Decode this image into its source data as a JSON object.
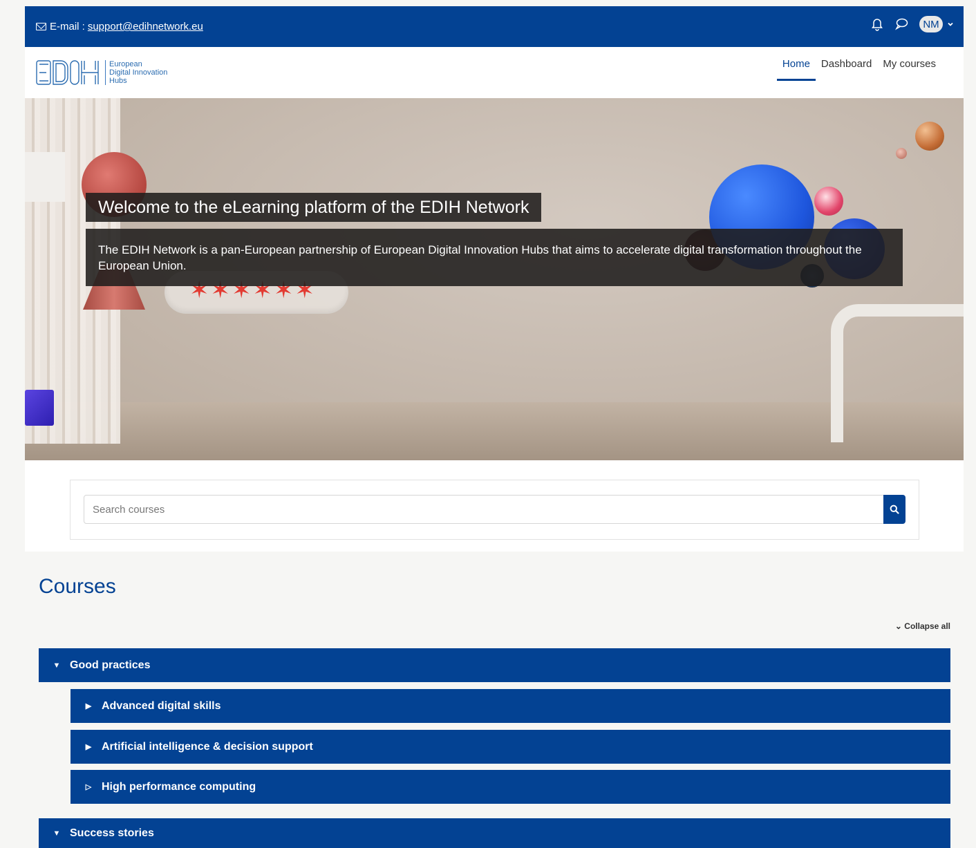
{
  "topbar": {
    "email_label": "E-mail :",
    "email_address": "support@edihnetwork.eu",
    "avatar_initials": "NM"
  },
  "logo": {
    "mark": "EDIH",
    "line1": "European",
    "line2": "Digital Innovation",
    "line3": "Hubs"
  },
  "nav": {
    "home": "Home",
    "dashboard": "Dashboard",
    "my_courses": "My courses"
  },
  "hero": {
    "title": "Welcome to the eLearning platform of the EDIH Network",
    "text": "The EDIH Network is a pan-European partnership of European Digital Innovation Hubs that aims to accelerate digital transformation throughout the European Union."
  },
  "search": {
    "placeholder": "Search courses"
  },
  "courses": {
    "title": "Courses",
    "collapse_all": "Collapse all",
    "categories": [
      {
        "label": "Good practices",
        "expanded": true
      },
      {
        "label": "Advanced digital skills",
        "expanded": false
      },
      {
        "label": "Artificial intelligence & decision support",
        "expanded": false
      },
      {
        "label": "High performance computing",
        "expanded": false
      },
      {
        "label": "Success stories",
        "expanded": true
      }
    ]
  },
  "colors": {
    "brand": "#034293",
    "hero_overlay": "#201e1d"
  }
}
